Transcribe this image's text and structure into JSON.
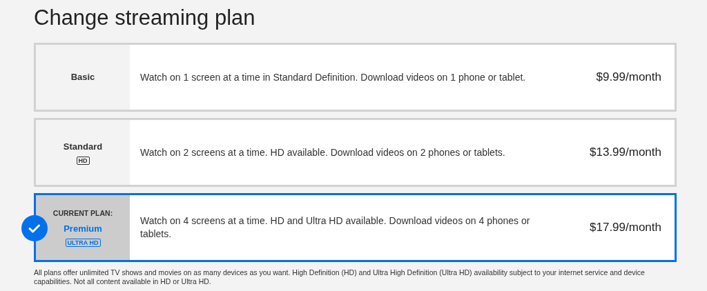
{
  "title": "Change streaming plan",
  "plans": [
    {
      "name": "Basic",
      "description": "Watch on 1 screen at a time in Standard Definition. Download videos on 1 phone or tablet.",
      "price": "$9.99/month",
      "selected": false
    },
    {
      "name": "Standard",
      "badge": "HD",
      "description": "Watch on 2 screens at a time. HD available. Download videos on 2 phones or tablets.",
      "price": "$13.99/month",
      "selected": false
    },
    {
      "name": "Premium",
      "current_label": "CURRENT PLAN:",
      "badge": "ULTRA HD",
      "description": "Watch on 4 screens at a time. HD and Ultra HD available. Download videos on 4 phones or tablets.",
      "price": "$17.99/month",
      "selected": true
    }
  ],
  "footnote": "All plans offer unlimited TV shows and movies on as many devices as you want. High Definition (HD) and Ultra High Definition (Ultra HD) availability subject to your internet service and device capabilities. Not all content available in HD or Ultra HD."
}
